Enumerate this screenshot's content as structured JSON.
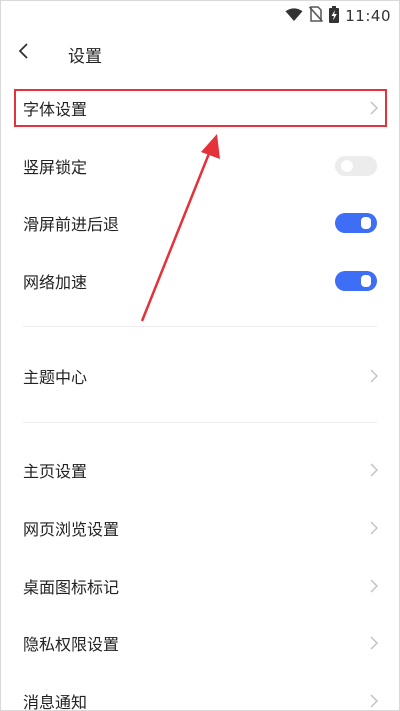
{
  "status_bar": {
    "time": "11:40",
    "icons": [
      "wifi-icon",
      "no-sim-icon",
      "battery-charging-icon"
    ]
  },
  "header": {
    "title": "设置",
    "back_icon": "chevron-left-icon"
  },
  "settings": {
    "font": {
      "label": "字体设置"
    },
    "lock_portrait": {
      "label": "竖屏锁定",
      "enabled": false
    },
    "swipe_nav": {
      "label": "滑屏前进后退",
      "enabled": true
    },
    "net_boost": {
      "label": "网络加速",
      "enabled": true
    },
    "theme_center": {
      "label": "主题中心"
    },
    "homepage": {
      "label": "主页设置"
    },
    "browsing": {
      "label": "网页浏览设置"
    },
    "desktop_icon_badge": {
      "label": "桌面图标标记"
    },
    "privacy": {
      "label": "隐私权限设置"
    },
    "notifications": {
      "label": "消息通知"
    }
  },
  "colors": {
    "accent": "#3d6ef5",
    "annotation": "#e5323a",
    "toggle_off": "#ececec"
  }
}
